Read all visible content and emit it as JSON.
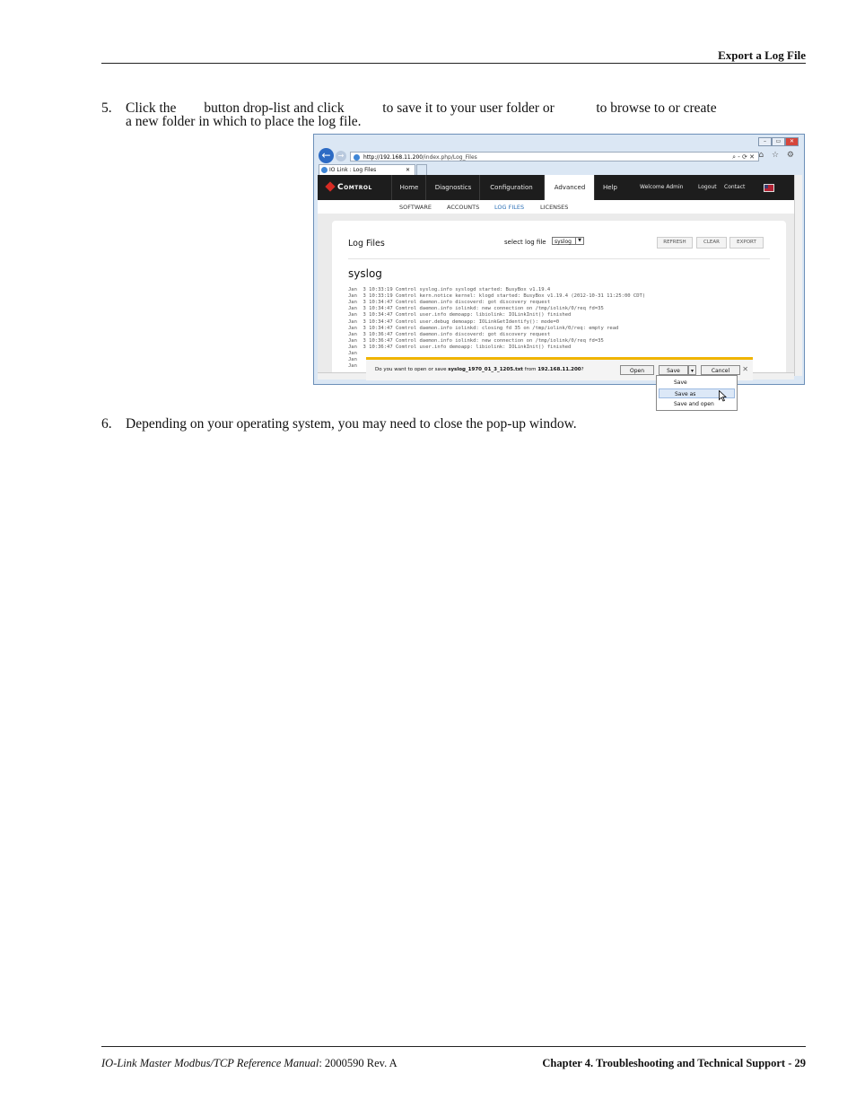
{
  "header": {
    "section_title": "Export a Log File"
  },
  "steps": [
    {
      "number": "5.",
      "line1": "Click the        button drop-list and click           to save it to your user folder or            to browse to or create",
      "line2": "a new folder in which to place the log file."
    },
    {
      "number": "6.",
      "line1": "Depending on your operating system, you may need to close the pop-up window."
    }
  ],
  "browser": {
    "url_host": "http://192.168.11.200",
    "url_path": "/index.php/Log_Files",
    "addr_tools": "⌕ - ⟳ ✕",
    "tab_title": "IO Link : Log Files",
    "tab_close": "✕",
    "window_controls": [
      "–",
      "▭",
      "✕"
    ],
    "toolbar_icons": "⌂ ☆ ⚙"
  },
  "app": {
    "brand": "Comtrol",
    "nav": [
      "Home",
      "Diagnostics",
      "Configuration",
      "Advanced",
      "Help"
    ],
    "nav_right": [
      "Welcome Admin",
      "Logout",
      "Contact"
    ],
    "subnav": [
      "SOFTWARE",
      "ACCOUNTS",
      "LOG FILES",
      "LICENSES"
    ],
    "panel_title": "Log Files",
    "select_label": "select log file",
    "select_value": "syslog",
    "buttons": [
      "REFRESH",
      "CLEAR",
      "EXPORT"
    ],
    "log_heading": "syslog",
    "log_lines": [
      "Jan  3 10:33:19 Comtrol syslog.info syslogd started: BusyBox v1.19.4",
      "Jan  3 10:33:19 Comtrol kern.notice kernel: klogd started: BusyBox v1.19.4 (2012-10-31 11:25:00 CDT)",
      "Jan  3 10:34:47 Comtrol daemon.info discoverd: got discovery request",
      "Jan  3 10:34:47 Comtrol daemon.info iolinkd: new connection on /tmp/iolink/0/req fd=35",
      "Jan  3 10:34:47 Comtrol user.info demoapp: libiolink: IOLinkInit() finished",
      "Jan  3 10:34:47 Comtrol user.debug demoapp: IOLinkGetIdentify(): mode=0",
      "Jan  3 10:34:47 Comtrol daemon.info iolinkd: closing fd 35 on /tmp/iolink/0/req: empty read",
      "Jan  3 10:36:47 Comtrol daemon.info discoverd: got discovery request",
      "Jan  3 10:36:47 Comtrol daemon.info iolinkd: new connection on /tmp/iolink/0/req fd=35",
      "Jan  3 10:36:47 Comtrol user.info demoapp: libiolink: IOLinkInit() finished",
      "Jan",
      "Jan",
      "Jan"
    ]
  },
  "download_bar": {
    "prefix": "Do you want to open or save ",
    "filename": "syslog_1970_01_3_1205.txt",
    "mid": " from ",
    "host": "192.168.11.200",
    "suffix": "?",
    "open": "Open",
    "save": "Save",
    "save_arrow": "▾",
    "cancel": "Cancel",
    "close": "✕"
  },
  "save_menu": [
    "Save",
    "Save as",
    "Save and open"
  ],
  "footer": {
    "manual_title": "IO-Link Master Modbus/TCP Reference Manual",
    "manual_rev": ": 2000590 Rev. A",
    "chapter": "Chapter 4. Troubleshooting and Technical Support  - 29"
  }
}
